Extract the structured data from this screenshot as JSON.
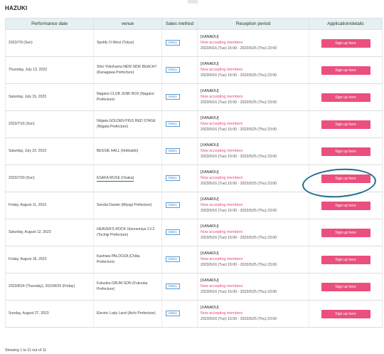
{
  "title": "HAZUKI",
  "headers": [
    "Performance date",
    "venue",
    "Sales method",
    "Reception period",
    "Application/details"
  ],
  "rows": [
    {
      "date": "2023/7/9 (Sun)",
      "venue": "Spotify O-West (Tokyo)",
      "method": "lottery",
      "rec_title": "[XANADU]",
      "rec_status": "Now accepting members",
      "rec_period": "2023/5/16 (Tue) 15:00 - 2023/5/25 (Thu) 23:00",
      "button": "Sign up here"
    },
    {
      "date": "Thursday, July 13, 2023",
      "venue": "Shin-Yokohama NEW SIDE BEACH!! (Kanagawa Prefecture)",
      "method": "lottery",
      "rec_title": "[XANADU]",
      "rec_status": "Now accepting members",
      "rec_period": "2023/5/16 (Tue) 15:00 - 2023/5/25 (Thu) 23:00",
      "button": "Sign up here"
    },
    {
      "date": "Saturday, July 15, 2023",
      "venue": "Nagano CLUB JUNK BOX (Nagano Prefecture)",
      "method": "lottery",
      "rec_title": "[XANADU]",
      "rec_status": "Now accepting members",
      "rec_period": "2023/5/16 (Tue) 15:00 - 2023/5/25 (Thu) 23:00",
      "button": "Sign up here"
    },
    {
      "date": "2023/7/16 (Sun)",
      "venue": "Niigata GOLDEN PIGS RED STAGE (Niigata Prefecture)",
      "method": "lottery",
      "rec_title": "[XANADU]",
      "rec_status": "Now accepting members",
      "rec_period": "2023/5/16 (Tue) 15:00 - 2023/5/25 (Thu) 23:00",
      "button": "Sign up here"
    },
    {
      "date": "Saturday, July 22, 2023",
      "venue": "BESSIE HALL (Hokkaido)",
      "method": "lottery",
      "rec_title": "[XANADU]",
      "rec_status": "Now accepting members",
      "rec_period": "2023/5/16 (Tue) 15:00 - 2023/5/25 (Thu) 23:00",
      "button": "Sign up here"
    },
    {
      "date": "2023/7/30 (Sun)",
      "venue": "ESAKA MUSE (Osaka)",
      "method": "lottery",
      "rec_title": "[XANADU]",
      "rec_status": "Now accepting members",
      "rec_period": "2023/5/16 (Tue) 15:00 - 2023/5/25 (Thu) 23:00",
      "button": "Sign up here"
    },
    {
      "date": "Friday, August 11, 2023",
      "venue": "Sendai Darwin (Miyagi Prefecture)",
      "method": "lottery",
      "rec_title": "[XANADU]",
      "rec_status": "Now accepting members",
      "rec_period": "2023/5/16 (Tue) 15:00 - 2023/5/25 (Thu) 23:00",
      "button": "Sign up here"
    },
    {
      "date": "Saturday, August 12, 2023",
      "venue": "HEAVEN'S ROCK Utsunomiya VJ-2 (Tochigi Prefecture)",
      "method": "lottery",
      "rec_title": "[XANADU]",
      "rec_status": "Now accepting members",
      "rec_period": "2023/5/16 (Tue) 15:00 - 2023/5/25 (Thu) 23:00",
      "button": "Sign up here"
    },
    {
      "date": "Friday, August 18, 2023",
      "venue": "Kashiwa PALOOZA (Chiba Prefecture)",
      "method": "lottery",
      "rec_title": "[XANADU]",
      "rec_status": "Now accepting members",
      "rec_period": "2023/5/16 (Tue) 15:00 - 2023/5/25 (Thu) 23:00",
      "button": "Sign up here"
    },
    {
      "date": "2023/8/24 (Thursday), 2023/8/25 (Friday)",
      "venue": "Fukuoka DRUM SON (Fukuoka Prefecture)",
      "method": "lottery",
      "rec_title": "[XANADU]",
      "rec_status": "Now accepting members",
      "rec_period": "2023/5/16 (Tue) 15:00 - 2023/5/25 (Thu) 23:00",
      "button": "Sign up here"
    },
    {
      "date": "Sunday, August 27, 2023",
      "venue": "Electric Lady Land (Aichi Prefecture)",
      "method": "lottery",
      "rec_title": "[XANADU]",
      "rec_status": "Now accepting members",
      "rec_period": "2023/5/16 (Tue) 15:00 - 2023/5/25 (Thu) 23:00",
      "button": "Sign up here"
    }
  ],
  "footer": "Showing 1 to 11 out of 11",
  "colors": {
    "accent": "#ea4f7d",
    "header_bg": "#e4f0f1",
    "lottery": "#3b82c4",
    "annotation": "#1c6f8d"
  }
}
